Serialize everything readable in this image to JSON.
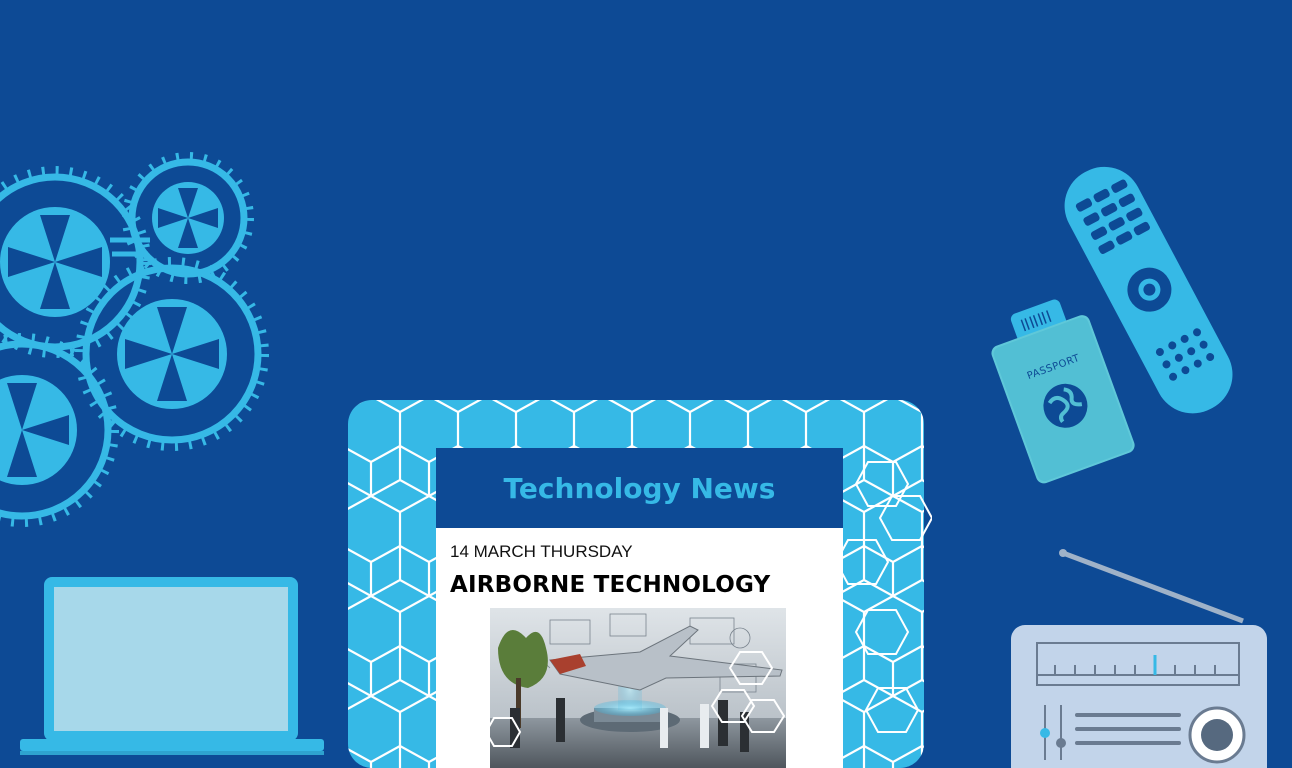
{
  "article": {
    "header": "Technology News",
    "date": "14 MARCH THURSDAY",
    "headline": "AIRBORNE TECHNOLOGY",
    "image_icon": "futuristic-jet-lab-illustration"
  },
  "decor": {
    "passport_label": "PASSPORT"
  },
  "colors": {
    "background": "#0d4a95",
    "accent": "#36b9e6",
    "card": "#ffffff",
    "radio": "#c2d4ea"
  }
}
